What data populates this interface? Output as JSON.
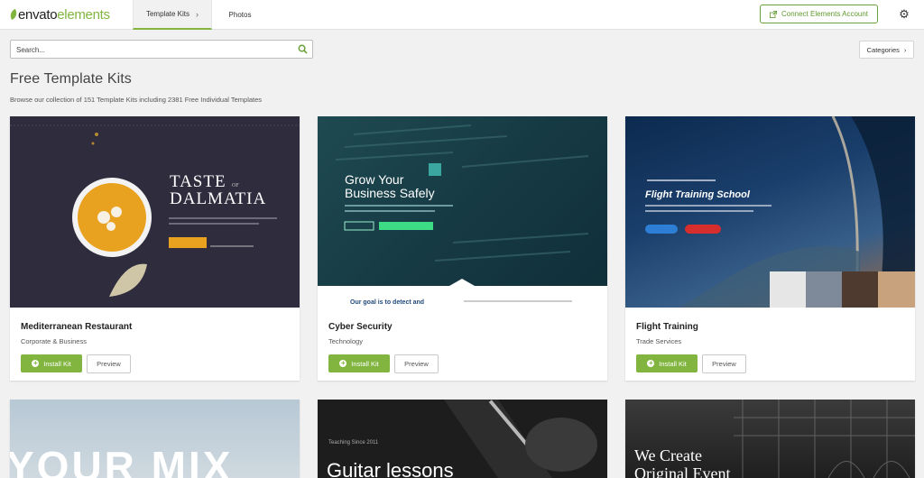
{
  "topbar": {
    "logo": {
      "part1": "envato",
      "part2": "elements"
    },
    "tabs": [
      {
        "label": "Template Kits"
      },
      {
        "label": "Photos"
      }
    ],
    "connect_label": "Connect Elements Account"
  },
  "search": {
    "placeholder": "Search...",
    "value": ""
  },
  "categories_label": "Categories",
  "page": {
    "title": "Free Template Kits",
    "subtitle": "Browse our collection of 151 Template Kits including 2381 Free Individual Templates"
  },
  "buttons": {
    "install": "Install Kit",
    "preview": "Preview"
  },
  "cards": [
    {
      "title": "Mediterranean Restaurant",
      "category": "Corporate & Business",
      "art": {
        "headline_1": "TASTE",
        "headline_of": "OF",
        "headline_2": "DALMATIA"
      }
    },
    {
      "title": "Cyber Security",
      "category": "Technology",
      "art": {
        "headline_1": "Grow Your",
        "headline_2": "Business Safely",
        "bottom_text": "Our goal is to detect and"
      }
    },
    {
      "title": "Flight Training",
      "category": "Trade Services",
      "art": {
        "headline": "Flight Training School"
      }
    },
    {
      "art": {
        "headline": "YOUR  MIX"
      }
    },
    {
      "art": {
        "small": "Teaching Since 2011",
        "headline": "Guitar lessons"
      }
    },
    {
      "art": {
        "headline_1": "We Create",
        "headline_2": "Original Event"
      }
    }
  ],
  "colors": {
    "accent": "#82b540",
    "accent_dark": "#5f9a2e",
    "page_bg": "#f1f1f1"
  }
}
